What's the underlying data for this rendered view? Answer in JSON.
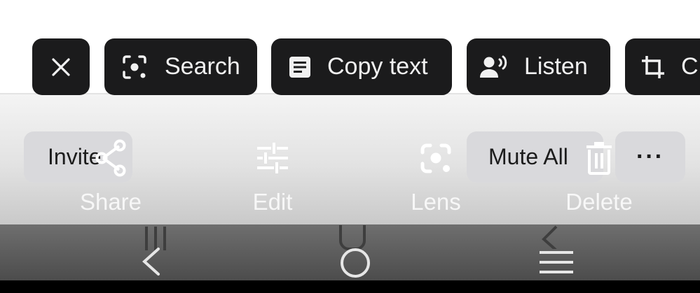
{
  "toolbar": {
    "close_icon": "close-icon",
    "chips": [
      {
        "label": "Search",
        "icon": "lens-search-icon"
      },
      {
        "label": "Copy text",
        "icon": "document-text-icon"
      },
      {
        "label": "Listen",
        "icon": "speaking-person-icon"
      },
      {
        "label": "C",
        "icon": "crop-icon"
      }
    ]
  },
  "call_controls": {
    "invite_label": "Invite",
    "mute_all_label": "Mute All",
    "more_label": "···"
  },
  "actions": [
    {
      "label": "Share",
      "icon": "share-icon"
    },
    {
      "label": "Edit",
      "icon": "sliders-icon"
    },
    {
      "label": "Lens",
      "icon": "lens-icon"
    },
    {
      "label": "Delete",
      "icon": "trash-icon"
    }
  ],
  "navigation": {
    "ghost_icons": [
      "recent-apps-icon",
      "home-icon",
      "back-icon"
    ],
    "icons": [
      "back-icon",
      "home-icon",
      "recent-apps-icon"
    ]
  },
  "colors": {
    "chip_bg": "#1b1b1c",
    "chip_text": "#f1f1f1",
    "action_text": "#ffffff",
    "nav_bg": "#555555"
  }
}
